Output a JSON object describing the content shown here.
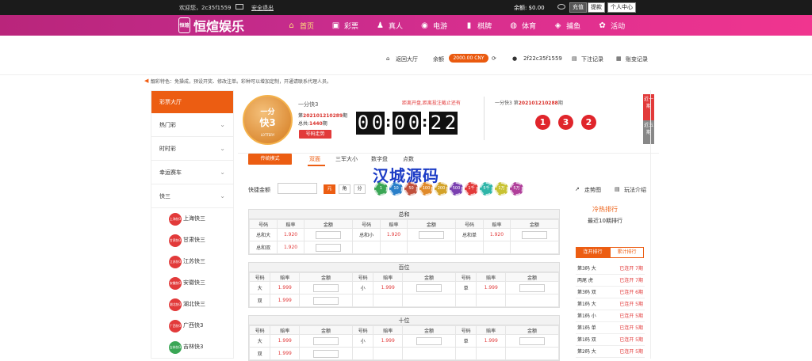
{
  "topbar": {
    "welcome": "欢迎您，2c35f1559",
    "logout": "安全退出",
    "balance": "余额: $0.00",
    "charge": "充值",
    "withdraw": "提款",
    "personal": "个人中心"
  },
  "brand": {
    "name": "恒煊娱乐",
    "seal": "恒煊"
  },
  "nav": [
    {
      "label": "首页",
      "icon": "home-icon",
      "glyph": "⌂"
    },
    {
      "label": "彩票",
      "icon": "ticket-icon",
      "glyph": "▣"
    },
    {
      "label": "真人",
      "icon": "person-icon",
      "glyph": "♟"
    },
    {
      "label": "电游",
      "icon": "gamepad-icon",
      "glyph": "◉"
    },
    {
      "label": "棋牌",
      "icon": "cards-icon",
      "glyph": "▮"
    },
    {
      "label": "体育",
      "icon": "ball-icon",
      "glyph": "◍"
    },
    {
      "label": "捕鱼",
      "icon": "fish-icon",
      "glyph": "◈"
    },
    {
      "label": "活动",
      "icon": "gift-icon",
      "glyph": "✿"
    }
  ],
  "subhead": {
    "lobby": "返回大厅",
    "balance_label": "余额",
    "amount": "2000.00 CNY",
    "user": "2f22c35f1559",
    "orders": "下注记录",
    "account": "账变记录"
  },
  "notice": "靓彩特色：免操成，预设开奖、修改注单。彩种可以增加定制，开通请联系代理人员。",
  "sidebar": {
    "head": "彩票大厅",
    "cats": [
      "热门彩",
      "时时彩",
      "幸运赛车",
      "快三"
    ],
    "subs": [
      {
        "label": "上海快三",
        "badge": "上海快3"
      },
      {
        "label": "甘肃快三",
        "badge": "甘肃快3"
      },
      {
        "label": "江苏快三",
        "badge": "江苏快3"
      },
      {
        "label": "安徽快三",
        "badge": "安徽快3"
      },
      {
        "label": "湖北快三",
        "badge": "湖北快3"
      },
      {
        "label": "广西快3",
        "badge": "广西快3"
      },
      {
        "label": "吉林快3",
        "badge": "吉林快3"
      }
    ]
  },
  "game": {
    "icon_top": "一分",
    "icon_mid": "快3",
    "icon_bottom": "LOTTERY",
    "name": "一分快3",
    "issue_prefix": "第",
    "issue": "202101210289",
    "issue_suffix": "期",
    "total_label": "总共:",
    "total": "1440",
    "total_suffix": "期",
    "trend": "号码走势",
    "closing": "距离开盘,距离投注截止还有",
    "digits": [
      "0",
      "0",
      "0",
      "0",
      "2",
      "2"
    ],
    "prev_label": "一分快3 第",
    "prev_issue": "202101210288",
    "prev_suffix": "期",
    "balls": [
      "1",
      "3",
      "2"
    ],
    "vtab1": "近一期",
    "vtab2": "近五期"
  },
  "tabs": {
    "mode": "传统模式",
    "items": [
      "双面",
      "三军大小",
      "数字盘",
      "点数"
    ]
  },
  "watermark": "汉城源码",
  "quick": {
    "label": "快捷金额",
    "units": [
      "元",
      "角",
      "分"
    ],
    "chips": [
      "1",
      "10",
      "50",
      "100",
      "200",
      "500",
      "1千",
      "5千",
      "1万",
      "5万"
    ],
    "trend": "走势图",
    "rules": "玩法介绍"
  },
  "tables": [
    {
      "title": "总和",
      "headers": [
        "号码",
        "赔率",
        "金额",
        "号码",
        "赔率",
        "金额",
        "号码",
        "赔率",
        "金额"
      ],
      "rows": [
        [
          [
            "总和大",
            "1.920"
          ],
          [
            "总和小",
            "1.920"
          ],
          [
            "总和单",
            "1.920"
          ]
        ],
        [
          [
            "总和双",
            "1.920"
          ]
        ]
      ]
    },
    {
      "title": "百位",
      "headers": [
        "号码",
        "赔率",
        "金额",
        "号码",
        "赔率",
        "金额",
        "号码",
        "赔率",
        "金额"
      ],
      "rows": [
        [
          [
            "大",
            "1.999"
          ],
          [
            "小",
            "1.999"
          ],
          [
            "单",
            "1.999"
          ]
        ],
        [
          [
            "双",
            "1.999"
          ]
        ]
      ]
    },
    {
      "title": "十位",
      "headers": [
        "号码",
        "赔率",
        "金额",
        "号码",
        "赔率",
        "金额",
        "号码",
        "赔率",
        "金额"
      ],
      "rows": [
        [
          [
            "大",
            "1.999"
          ],
          [
            "小",
            "1.999"
          ],
          [
            "单",
            "1.999"
          ]
        ],
        [
          [
            "双",
            "1.999"
          ]
        ]
      ]
    }
  ],
  "ranking": {
    "title": "冷热排行",
    "subtitle": "最近10期排行",
    "tabs": [
      "连开排行",
      "累计排行"
    ],
    "rows": [
      [
        "第3码 大",
        "已连开 7期"
      ],
      [
        "两尾 虎",
        "已连开 7期"
      ],
      [
        "第3码 双",
        "已连开 6期"
      ],
      [
        "第1码 大",
        "已连开 5期"
      ],
      [
        "第1码 小",
        "已连开 5期"
      ],
      [
        "第1码 单",
        "已连开 5期"
      ],
      [
        "第1码 双",
        "已连开 5期"
      ],
      [
        "第2码 大",
        "已连开 5期"
      ]
    ]
  },
  "colors": {
    "accent": "#ec5d12",
    "red": "#e23a3a",
    "nav_start": "#b9257b",
    "nav_end": "#f0358f"
  }
}
